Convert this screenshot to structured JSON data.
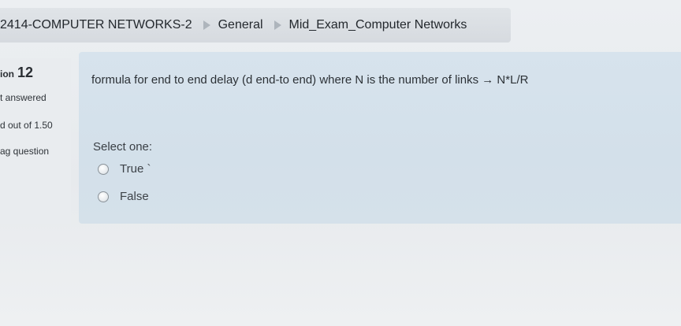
{
  "breadcrumb": {
    "course": "2414-COMPUTER NETWORKS-2",
    "section": "General",
    "quiz": "Mid_Exam_Computer Networks"
  },
  "question_info": {
    "label": "ion",
    "number": "12",
    "state": "t answered",
    "mark": "d out of 1.50",
    "flag": "ag question"
  },
  "question": {
    "text": "formula for end to end delay (d end-to end) where N is the number of links → N*L/R",
    "prompt": "Select one:",
    "options": [
      {
        "label": "True `"
      },
      {
        "label": "False"
      }
    ]
  }
}
